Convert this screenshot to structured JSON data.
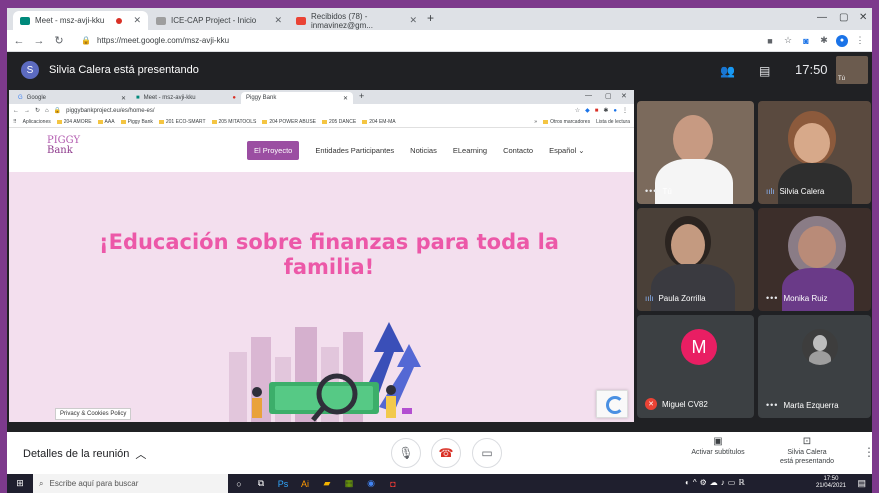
{
  "browser": {
    "tabs": [
      {
        "title": "Meet - msz-avji-kku",
        "active": true
      },
      {
        "title": "ICE-CAP Project - Inicio",
        "active": false
      },
      {
        "title": "Recibidos (78) - inmavinez@gm...",
        "active": false
      }
    ],
    "url": "https://meet.google.com/msz-avji-kku"
  },
  "meet": {
    "presenter_initial": "S",
    "presenting_text": "Silvia Calera está presentando",
    "time": "17:50",
    "self_label": "Tú",
    "details_label": "Detalles de la reunión",
    "captions_label": "Activar subtítulos",
    "presenting_btn_line1": "Silvia Calera",
    "presenting_btn_line2": "está presentando",
    "participants": [
      {
        "name": "Tú",
        "indicator": "dots"
      },
      {
        "name": "Silvia Calera",
        "indicator": "bars"
      },
      {
        "name": "Paula Zorrilla",
        "indicator": "bars"
      },
      {
        "name": "Monika Ruiz",
        "indicator": "dots"
      },
      {
        "name": "Miguel CV82",
        "indicator": "muted",
        "initial": "M"
      },
      {
        "name": "Marta Ezquerra",
        "indicator": "dots"
      }
    ]
  },
  "shared": {
    "tabs": [
      "Google",
      "Meet - msz-avji-kku",
      "Piggy Bank"
    ],
    "url": "piggybankproject.eu/es/home-es/",
    "bookmarks": [
      "Aplicaciones",
      "204 AMORE",
      "AAA",
      "Piggy Bank",
      "201 ECO-SMART",
      "205 MITATOOLS",
      "204 POWER ABUSE",
      "205 DANCE",
      "204 EM-MA",
      "Otros marcadores",
      "Lista de lectura"
    ],
    "logo_top": "PIGGY",
    "logo_bottom": "Bank",
    "menu": [
      "El Proyecto",
      "Entidades Participantes",
      "Noticias",
      "ELearning",
      "Contacto",
      "Español ⌄"
    ],
    "headline_line1": "¡Educación sobre finanzas para toda la",
    "headline_line2": "familia!",
    "privacy": "Privacy & Cookies Policy"
  },
  "taskbar": {
    "search_placeholder": "Escribe aquí para buscar",
    "time": "17:50",
    "date": "21/04/2021"
  },
  "colors": {
    "frame_bg": "#7d3a8c",
    "meet_bg": "#202124",
    "headline": "#ec58a8",
    "hero_bg": "#f3dfee",
    "menu_active": "#9b4ea2",
    "avatar_m": "#e91e63"
  }
}
